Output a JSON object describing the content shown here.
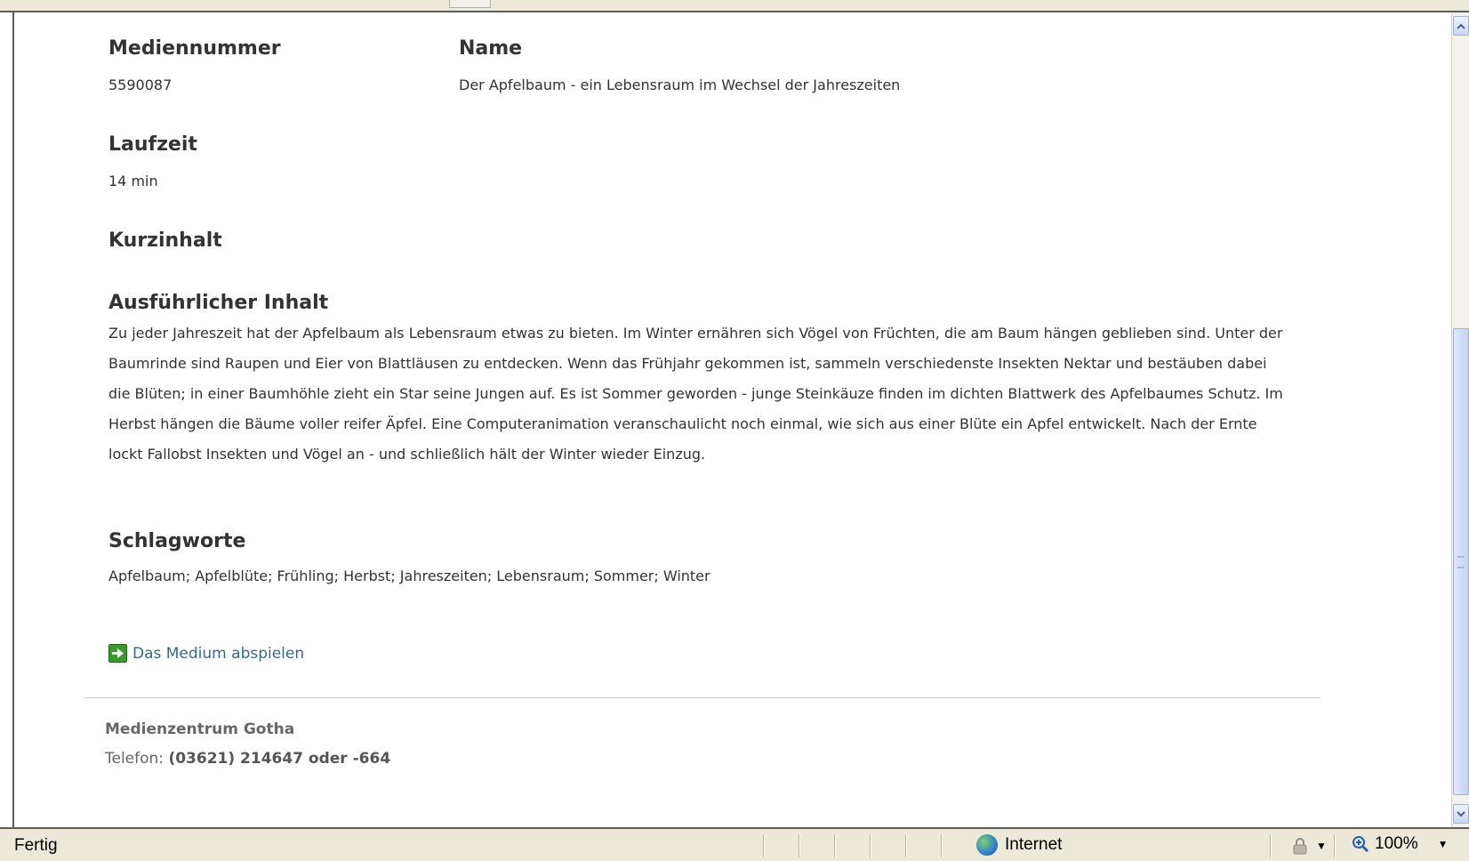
{
  "media": {
    "number_label": "Mediennummer",
    "number_value": "5590087",
    "name_label": "Name",
    "name_value": "Der Apfelbaum - ein Lebensraum im Wechsel der Jahreszeiten",
    "runtime_label": "Laufzeit",
    "runtime_value": "14 min",
    "summary_label": "Kurzinhalt",
    "detail_label": "Ausführlicher Inhalt",
    "detail_text": "Zu jeder Jahreszeit hat der Apfelbaum als Lebensraum etwas zu bieten. Im Winter ernähren sich Vögel von Früchten, die am Baum hängen geblieben sind. Unter der Baumrinde sind Raupen und Eier von Blattläusen zu entdecken. Wenn das Frühjahr gekommen ist, sammeln verschiedenste Insekten Nektar und bestäuben dabei die Blüten; in einer Baumhöhle zieht ein Star seine Jungen auf. Es ist Sommer geworden - junge Steinkäuze finden im dichten Blattwerk des Apfelbaumes Schutz. Im Herbst hängen die Bäume voller reifer Äpfel. Eine Computeranimation veranschaulicht noch einmal, wie sich aus einer Blüte ein Apfel entwickelt. Nach der Ernte lockt Fallobst Insekten und Vögel an - und schließlich hält der Winter wieder Einzug.",
    "keywords_label": "Schlagworte",
    "keywords_value": "Apfelbaum; Apfelblüte; Frühling; Herbst; Jahreszeiten; Lebensraum; Sommer; Winter",
    "play_link": "Das Medium abspielen",
    "play_icon": "play-arrow-icon"
  },
  "footer": {
    "org_name": "Medienzentrum Gotha",
    "phone_label": "Telefon:",
    "phone_value": "(03621) 214647 oder -664"
  },
  "statusbar": {
    "status_text": "Fertig",
    "zone": "Internet",
    "zoom": "100%"
  },
  "colors": {
    "link": "#336b8a",
    "text": "#333333",
    "footer_text": "#666666",
    "play_icon": "#3a9a2d"
  }
}
